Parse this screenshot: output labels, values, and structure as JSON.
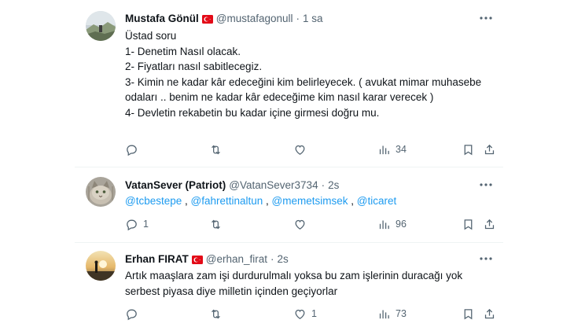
{
  "tweets": [
    {
      "name": "Mustafa Gönül",
      "has_flag": true,
      "handle": "@mustafagonull",
      "separator": "·",
      "time": "1 sa",
      "lines": [
        "Üstad soru",
        "1- Denetim Nasıl olacak.",
        "2- Fiyatları nasıl sabitlecegiz.",
        "3- Kimin ne kadar kâr edeceğini kim belirleyecek. ( avukat mimar muhasebe odaları .. benim ne kadar kâr edeceğime kim nasıl karar verecek )",
        "4- Devletin rekabetin bu kadar içine girmesi doğru mu."
      ],
      "replies": "",
      "retweets": "",
      "likes": "",
      "views": "34",
      "avatar": "landscape-photo-avatar"
    },
    {
      "name": "VatanSever (Patriot)",
      "has_flag": false,
      "handle": "@VatanSever3734",
      "separator": "·",
      "time": "2s",
      "mentions": [
        "@tcbestepe",
        "@fahrettinaltun",
        "@memetsimsek",
        "@ticaret"
      ],
      "mention_sep": " , ",
      "replies": "1",
      "retweets": "",
      "likes": "",
      "views": "96",
      "avatar": "cat-photo-avatar"
    },
    {
      "name": "Erhan FIRAT",
      "has_flag": true,
      "handle": "@erhan_firat",
      "separator": "·",
      "time": "2s",
      "lines": [
        "Artık maaşlara zam işi durdurulmalı yoksa bu zam işlerinin duracağı yok serbest piyasa diye milletin içinden geçiyorlar"
      ],
      "replies": "",
      "retweets": "",
      "likes": "1",
      "views": "73",
      "avatar": "sunset-photo-avatar"
    }
  ],
  "colors": {
    "text": "#0f1419",
    "secondary": "#536471",
    "link": "#1d9bf0",
    "border": "#eff3f4",
    "flag_red": "#e30a17"
  }
}
